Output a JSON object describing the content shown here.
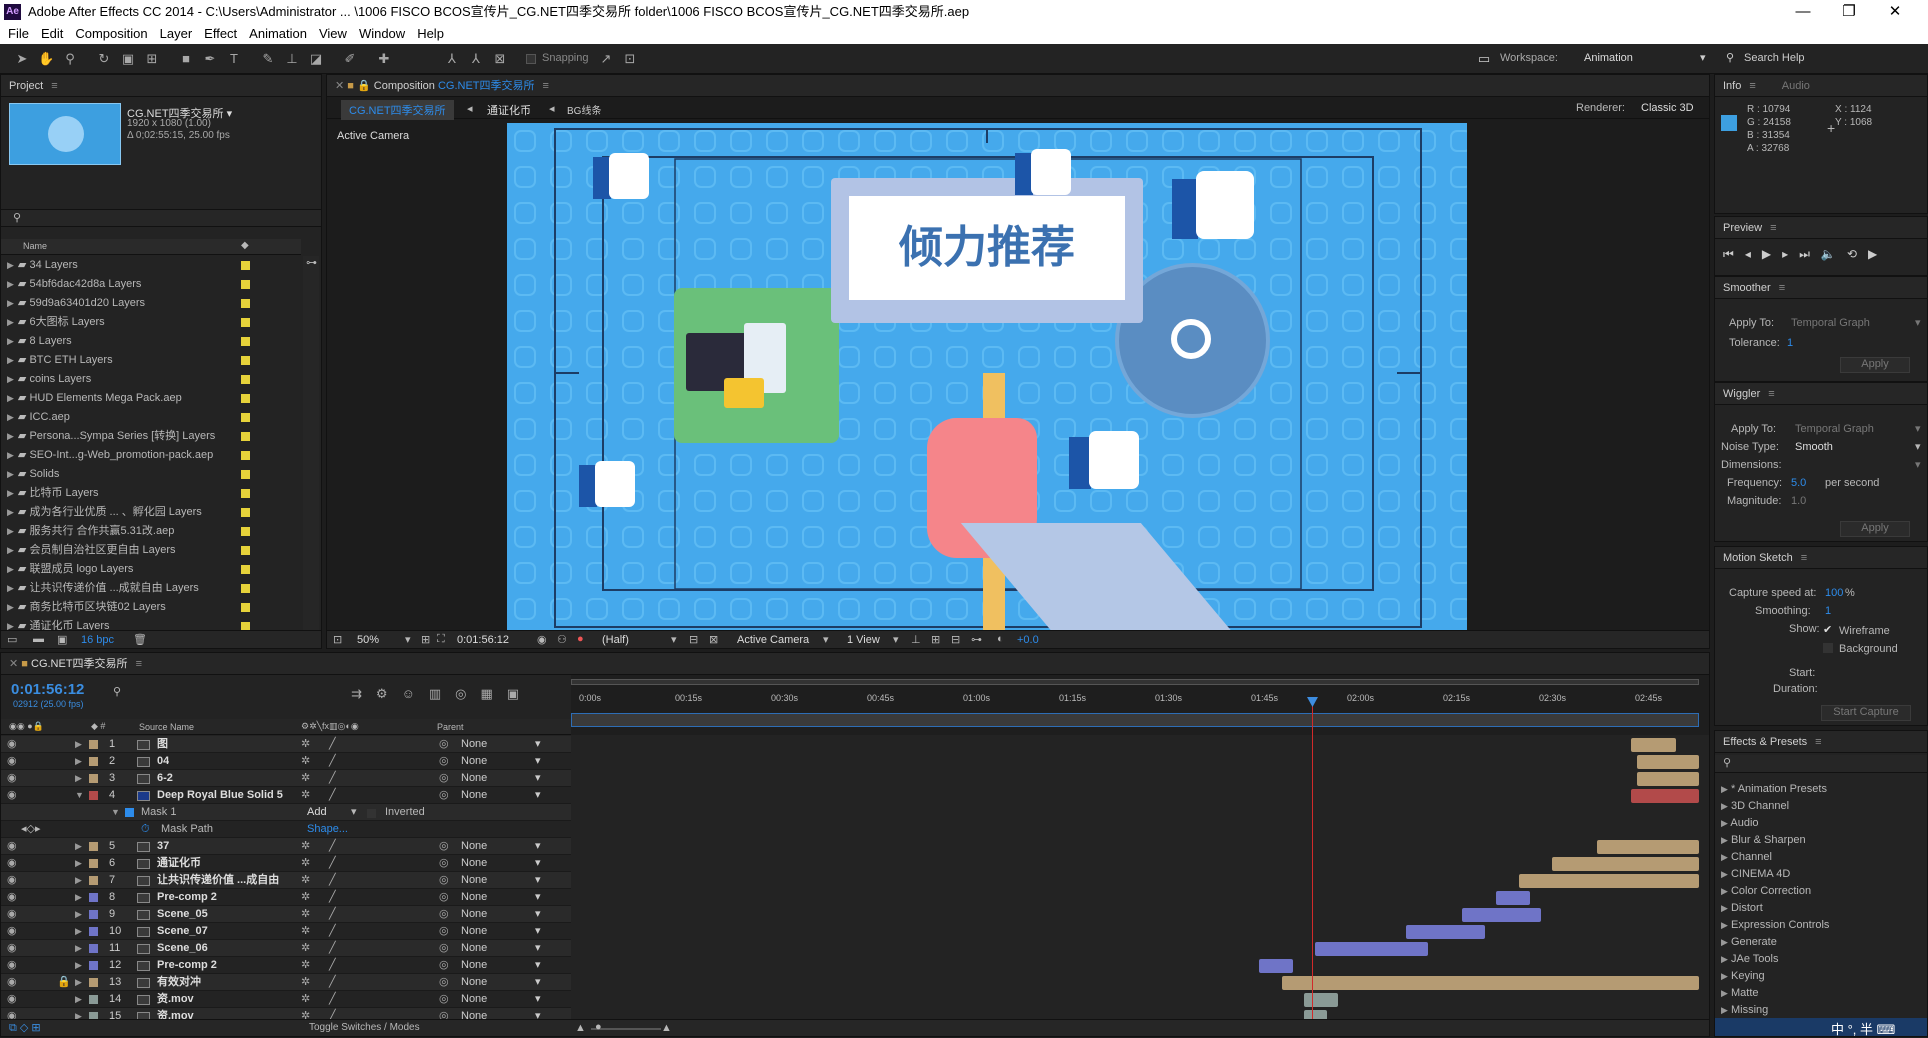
{
  "window": {
    "title": "Adobe After Effects CC 2014 - C:\\Users\\Administrator ... \\1006 FISCO BCOS宣传片_CG.NET四季交易所 folder\\1006 FISCO BCOS宣传片_CG.NET四季交易所.aep",
    "logo": "Ae"
  },
  "menu": [
    "File",
    "Edit",
    "Composition",
    "Layer",
    "Effect",
    "Animation",
    "View",
    "Window",
    "Help"
  ],
  "toolbar": {
    "snapping": "Snapping",
    "workspace_label": "Workspace:",
    "workspace": "Animation",
    "search_help": "Search Help"
  },
  "project": {
    "tab": "Project",
    "comp_name": "CG.NET四季交易所 ▾",
    "comp_res": "1920 x 1080 (1.00)",
    "comp_dur": "Δ 0;02:55:15, 25.00 fps",
    "col_name": "Name",
    "items": [
      "34 Layers",
      "54bf6dac42d8a Layers",
      "59d9a63401d20 Layers",
      "6大图标 Layers",
      "8 Layers",
      "BTC ETH Layers",
      "coins Layers",
      "HUD Elements Mega Pack.aep",
      "ICC.aep",
      "Persona...Sympa Series [转换] Layers",
      "SEO-Int...g-Web_promotion-pack.aep",
      "Solids",
      "比特币 Layers",
      "成为各行业优质 ... 、孵化园 Layers",
      "服务共行 合作共赢5.31改.aep",
      "会员制自治社区更自由 Layers",
      "联盟成员 logo Layers",
      "让共识传递价值 ...成就自由 Layers",
      "商务比特币区块链02 Layers",
      "通证化币 Layers"
    ],
    "bpc": "16 bpc"
  },
  "composition": {
    "tab_prefix": "Composition",
    "tab_name": "CG.NET四季交易所",
    "crumbs": [
      "CG.NET四季交易所",
      "通证化币",
      "BG线条"
    ],
    "renderer_label": "Renderer:",
    "renderer": "Classic 3D",
    "camera_label": "Active Camera",
    "sign_text": "倾力推荐",
    "zoom": "50%",
    "timecode": "0:01:56:12",
    "resolution": "(Half)",
    "camera": "Active Camera",
    "view": "1 View",
    "exposure": "+0.0"
  },
  "info": {
    "tab": "Info",
    "tab2": "Audio",
    "r": "R : 10794",
    "g": "G : 24158",
    "b": "B : 31354",
    "a": "A : 32768",
    "x": "X : 1124",
    "y": "Y : 1068",
    "swatch": "#3d9fe0"
  },
  "preview": {
    "tab": "Preview"
  },
  "smoother": {
    "tab": "Smoother",
    "apply_to_label": "Apply To:",
    "apply_to": "Temporal Graph",
    "tolerance_label": "Tolerance:",
    "tolerance": "1",
    "apply": "Apply"
  },
  "wiggler": {
    "tab": "Wiggler",
    "apply_to_label": "Apply To:",
    "apply_to": "Temporal Graph",
    "noise_label": "Noise Type:",
    "noise": "Smooth",
    "dimensions_label": "Dimensions:",
    "frequency_label": "Frequency:",
    "frequency": "5.0",
    "per_second": "per second",
    "magnitude_label": "Magnitude:",
    "magnitude": "1.0",
    "apply": "Apply"
  },
  "motion_sketch": {
    "tab": "Motion Sketch",
    "capture_label": "Capture speed at:",
    "capture": "100",
    "pct": "%",
    "smoothing_label": "Smoothing:",
    "smoothing": "1",
    "show_label": "Show:",
    "wireframe": "Wireframe",
    "background": "Background",
    "start_label": "Start:",
    "duration_label": "Duration:",
    "start_capture": "Start Capture"
  },
  "effects": {
    "tab": "Effects & Presets",
    "items": [
      "* Animation Presets",
      "3D Channel",
      "Audio",
      "Blur & Sharpen",
      "Channel",
      "CINEMA 4D",
      "Color Correction",
      "Distort",
      "Expression Controls",
      "Generate",
      "JAe Tools",
      "Keying",
      "Matte",
      "Missing"
    ]
  },
  "timeline": {
    "tab": "CG.NET四季交易所",
    "timecode": "0:01:56:12",
    "frames": "02912 (25.00 fps)",
    "col_source": "Source Name",
    "col_parent": "Parent",
    "toggle": "Toggle Switches / Modes",
    "ruler": [
      "0:00s",
      "00:15s",
      "00:30s",
      "00:45s",
      "01:00s",
      "01:15s",
      "01:30s",
      "01:45s",
      "02:00s",
      "02:15s",
      "02:30s",
      "02:45s"
    ],
    "mask": {
      "name": "Mask 1",
      "mode": "Add",
      "inverted": "Inverted",
      "path": "Mask Path",
      "shape": "Shape..."
    },
    "layers": [
      {
        "num": "1",
        "name": "图",
        "color": "#b59b73",
        "parent": "None",
        "start": 0.94,
        "end": 0.98
      },
      {
        "num": "2",
        "name": "04",
        "color": "#b59b73",
        "parent": "None",
        "start": 0.945,
        "end": 1.0
      },
      {
        "num": "3",
        "name": "6-2",
        "color": "#b59b73",
        "parent": "None",
        "start": 0.945,
        "end": 1.0
      },
      {
        "num": "4",
        "name": "Deep Royal Blue Solid 5",
        "color": "#b24a4a",
        "parent": "None",
        "start": 0.94,
        "end": 1.0
      },
      {
        "num": "5",
        "name": "37",
        "color": "#b59b73",
        "parent": "None",
        "start": 0.91,
        "end": 1.0
      },
      {
        "num": "6",
        "name": "通证化币",
        "color": "#b59b73",
        "parent": "None",
        "start": 0.87,
        "end": 1.0
      },
      {
        "num": "7",
        "name": "让共识传递价值 ...成自由",
        "color": "#b59b73",
        "parent": "None",
        "start": 0.84,
        "end": 1.0
      },
      {
        "num": "8",
        "name": "Pre-comp 2",
        "color": "#6f74c7",
        "parent": "None",
        "start": 0.82,
        "end": 0.85
      },
      {
        "num": "9",
        "name": "Scene_05",
        "color": "#6f74c7",
        "parent": "None",
        "start": 0.79,
        "end": 0.86
      },
      {
        "num": "10",
        "name": "Scene_07",
        "color": "#6f74c7",
        "parent": "None",
        "start": 0.74,
        "end": 0.81
      },
      {
        "num": "11",
        "name": "Scene_06",
        "color": "#6f74c7",
        "parent": "None",
        "start": 0.66,
        "end": 0.76
      },
      {
        "num": "12",
        "name": "Pre-comp 2",
        "color": "#6f74c7",
        "parent": "None",
        "start": 0.61,
        "end": 0.64
      },
      {
        "num": "13",
        "name": "有效对冲",
        "color": "#b59b73",
        "parent": "None",
        "start": 0.63,
        "end": 1.0
      },
      {
        "num": "14",
        "name": "资.mov",
        "color": "#8a9a96",
        "parent": "None",
        "start": 0.65,
        "end": 0.68
      },
      {
        "num": "15",
        "name": "资.mov",
        "color": "#8a9a96",
        "parent": "None",
        "start": 0.65,
        "end": 0.67
      }
    ]
  }
}
